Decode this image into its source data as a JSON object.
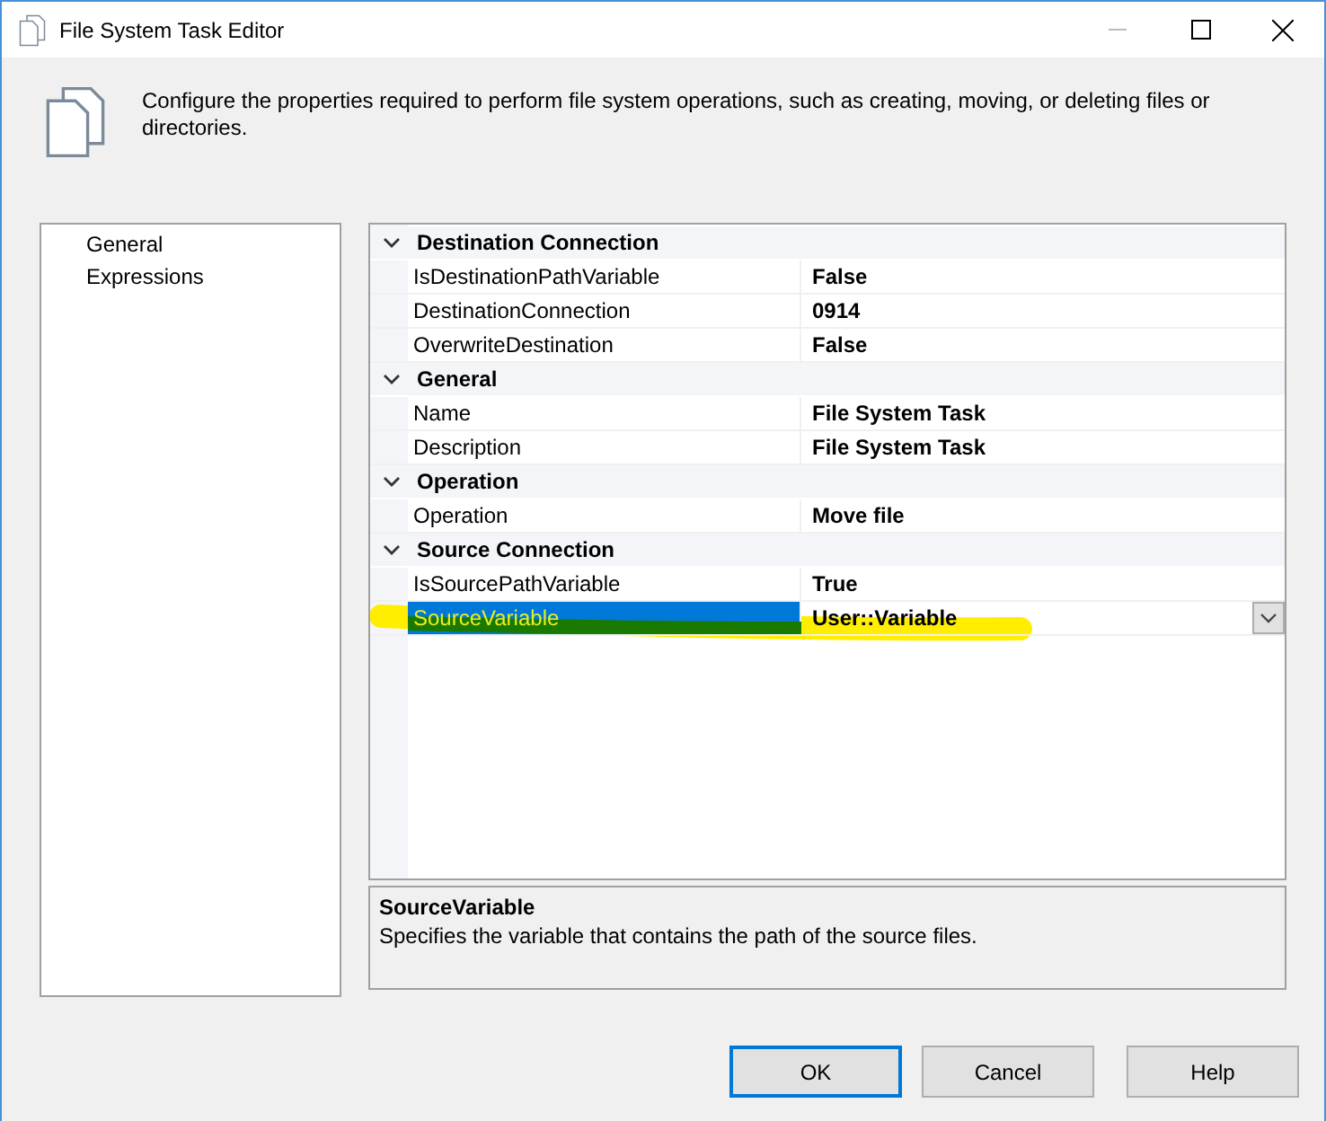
{
  "window": {
    "title": "File System Task Editor"
  },
  "header": {
    "description": "Configure the properties required to perform file system operations, such as creating, moving, or deleting files or directories."
  },
  "pages": [
    {
      "label": "General",
      "selected": false
    },
    {
      "label": "Expressions",
      "selected": false
    }
  ],
  "categories": [
    {
      "name": "Destination Connection",
      "expanded": true,
      "properties": [
        {
          "name": "IsDestinationPathVariable",
          "value": "False",
          "selected": false
        },
        {
          "name": "DestinationConnection",
          "value": "0914",
          "selected": false
        },
        {
          "name": "OverwriteDestination",
          "value": "False",
          "selected": false
        }
      ]
    },
    {
      "name": "General",
      "expanded": true,
      "properties": [
        {
          "name": "Name",
          "value": "File System Task",
          "selected": false
        },
        {
          "name": "Description",
          "value": "File System Task",
          "selected": false
        }
      ]
    },
    {
      "name": "Operation",
      "expanded": true,
      "properties": [
        {
          "name": "Operation",
          "value": "Move file",
          "selected": false
        }
      ]
    },
    {
      "name": "Source Connection",
      "expanded": true,
      "properties": [
        {
          "name": "IsSourcePathVariable",
          "value": "True",
          "selected": false
        },
        {
          "name": "SourceVariable",
          "value": "User::Variable",
          "selected": true
        }
      ]
    }
  ],
  "description": {
    "title": "SourceVariable",
    "text": "Specifies the variable that contains the path of the source files."
  },
  "buttons": [
    {
      "label": "OK",
      "default": true
    },
    {
      "label": "Cancel",
      "default": false
    },
    {
      "label": "Help",
      "default": false
    }
  ]
}
